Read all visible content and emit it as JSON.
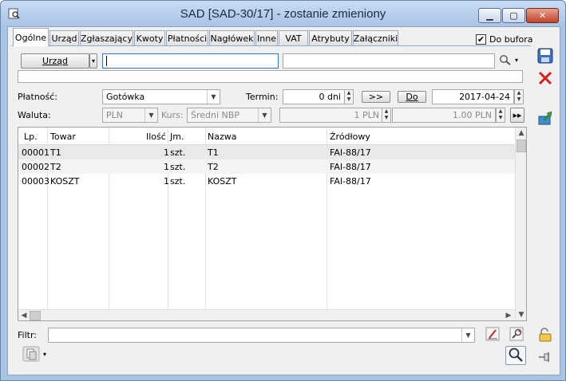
{
  "window": {
    "title": "SAD [SAD-30/17]  - zostanie zmieniony",
    "minimize_glyph": "▁",
    "maximize_glyph": "▢",
    "close_glyph": "✕"
  },
  "tabs": [
    {
      "label": "Ogólne",
      "active": true
    },
    {
      "label": "Urząd"
    },
    {
      "label": "Zgłaszający"
    },
    {
      "label": "Kwoty"
    },
    {
      "label": "Płatności"
    },
    {
      "label": "Nagłówek"
    },
    {
      "label": "Inne"
    },
    {
      "label": "VAT"
    },
    {
      "label": "Atrybuty"
    },
    {
      "label": "Załączniki"
    }
  ],
  "do_bufora": {
    "label": "Do bufora",
    "checked": true,
    "glyph": "✔"
  },
  "urzad": {
    "button_label": "Urząd",
    "dropdown_glyph": "▾",
    "code_value": "",
    "name_value": "",
    "lookup_glyph": "▾"
  },
  "payment": {
    "label": "Płatność:",
    "value": "Gotówka",
    "arrow": "▼",
    "termin_label": "Termin:",
    "termin_value": "0 dni",
    "advance_label": ">>",
    "do_label": "Do",
    "date_value": "2017-04-24",
    "spin_up": "▲",
    "spin_down": "▼"
  },
  "currency": {
    "label": "Waluta:",
    "value": "PLN",
    "arrow": "▼",
    "kurs_label": "Kurs:",
    "kurs_value": "Średni NBP",
    "amount_1": "1 PLN",
    "amount_2": "1.00 PLN",
    "spin_up": "▲",
    "spin_down": "▼",
    "forward_glyph": "▶▶"
  },
  "grid": {
    "headers": [
      "Lp.",
      "Towar",
      "Ilość",
      "Jm.",
      "Nazwa",
      "Źródłowy"
    ],
    "rows": [
      {
        "lp": "00001",
        "towar": "T1",
        "ilosc": "1",
        "jm": "szt.",
        "nazwa": "T1",
        "zrodlowy": "FAI-88/17"
      },
      {
        "lp": "00002",
        "towar": "T2",
        "ilosc": "1",
        "jm": "szt.",
        "nazwa": "T2",
        "zrodlowy": "FAI-88/17"
      },
      {
        "lp": "00003",
        "towar": "KOSZT",
        "ilosc": "1",
        "jm": "szt.",
        "nazwa": "KOSZT",
        "zrodlowy": "FAI-88/17"
      }
    ],
    "scroll_up": "▲",
    "scroll_down": "▼",
    "scroll_left": "◀",
    "scroll_right": "▶"
  },
  "filter": {
    "label": "Filtr:",
    "value": "",
    "arrow": "▼",
    "dropdown_glyph": "▾"
  },
  "colors": {
    "accent": "#3a78c8",
    "selected_row": "#e9e9e9",
    "window_frame": "#a9c4e6"
  }
}
